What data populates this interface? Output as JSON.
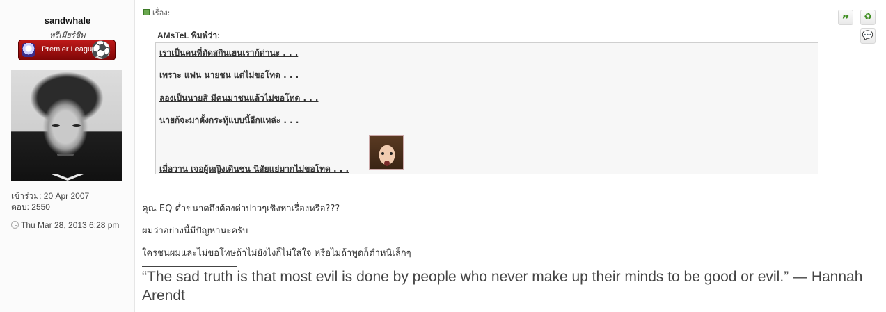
{
  "profile": {
    "username": "sandwhale",
    "rank_title": "พรีเมียร์ชิพ",
    "rank_badge": "Premier League",
    "joined": "เข้าร่วม: 20 Apr 2007",
    "posts": "ตอบ: 2550",
    "avatar_icon": "avatar-portrait"
  },
  "post": {
    "subject_label": "เรื่อง:",
    "timestamp": "Thu Mar 28, 2013 6:28 pm",
    "actions": {
      "quote": "”",
      "thanks": "♻",
      "pm": "💬"
    },
    "quote": {
      "author": "AMsTeL พิมพ์ว่า:",
      "lines": [
        "เราเป็นคนที่ตัดสกินเฮนเราก้ด่านะ . . .",
        "เพราะ แฟน นายชน แต่ไม่ขอโทด . . .",
        "ลองเป็นนายสิ มีคนมาชนแล้วไม่ขอโทด . . .",
        "นายก้จะมาตั้งกระทู้แบบนี้อีกแหล่ะ . . .",
        "เมื่อวาน เจอผู้หญิงเดินชน นิสัยแย่มากไม่ขอโทด . . ."
      ]
    },
    "body": [
      "คุณ EQ ต่ำขนาดถึงต้องด่าปาวๆเชิงหาเรื่องหรือ???",
      "ผมว่าอย่างนี้มีปัญหานะครับ",
      "ใครชนผมและไม่ขอโทษถ้าไม่ยังไงก็ไม่ใส่ใจ หรือไม่ถ้าพูดก็ตำหนิเล็กๆ"
    ],
    "signature": "“The sad truth is that most evil is done by people who never make up their minds to be good or evil.” — Hannah Arendt"
  },
  "colors": {
    "badge_red": "#a40f0f",
    "action_green": "#3c8c1e",
    "action_blue": "#1b6fc2",
    "quote_bg": "#f7f7f7"
  }
}
